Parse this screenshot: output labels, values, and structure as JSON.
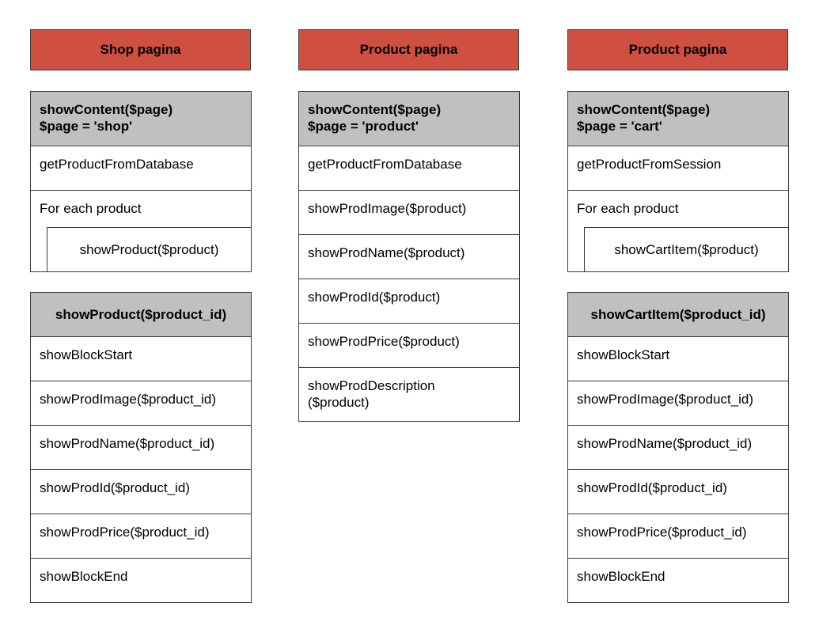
{
  "columns": [
    {
      "header": "Shop pagina",
      "content_block": {
        "title_line1": "showContent($page)",
        "title_line2": "$page = 'shop'",
        "first_row": "getProductFromDatabase",
        "loop_label": "For each product",
        "loop_call": "showProduct($product)"
      },
      "function_block": {
        "title": "showProduct($product_id)",
        "rows": [
          "showBlockStart",
          "showProdImage($product_id)",
          "showProdName($product_id)",
          "showProdId($product_id)",
          "showProdPrice($product_id)",
          "showBlockEnd"
        ]
      }
    },
    {
      "header": "Product pagina",
      "content_block": {
        "title_line1": "showContent($page)",
        "title_line2": "$page = 'product'",
        "rows": [
          "getProductFromDatabase",
          "showProdImage($product)",
          "showProdName($product)",
          "showProdId($product)",
          "showProdPrice($product)"
        ],
        "last_row_line1": "showProdDescription",
        "last_row_line2": "($product)"
      }
    },
    {
      "header": "Product pagina",
      "content_block": {
        "title_line1": "showContent($page)",
        "title_line2": "$page = 'cart'",
        "first_row": "getProductFromSession",
        "loop_label": "For each product",
        "loop_call": "showCartItem($product)"
      },
      "function_block": {
        "title": "showCartItem($product_id)",
        "rows": [
          "showBlockStart",
          "showProdImage($product_id)",
          "showProdName($product_id)",
          "showProdId($product_id)",
          "showProdPrice($product_id)",
          "showBlockEnd"
        ]
      }
    }
  ],
  "colors": {
    "header_fill": "#cf4f41",
    "title_fill": "#c0c0c0",
    "row_fill": "#ffffff",
    "stroke": "#3a3a3a"
  }
}
